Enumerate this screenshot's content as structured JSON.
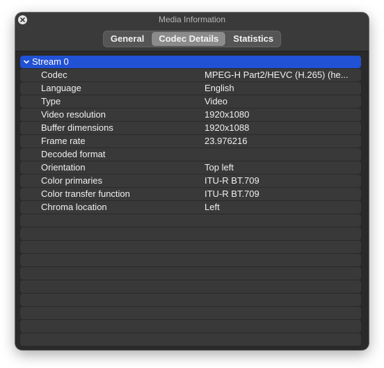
{
  "window": {
    "title": "Media Information",
    "close_icon": "close-icon"
  },
  "tabs": [
    {
      "label": "General",
      "active": false
    },
    {
      "label": "Codec Details",
      "active": true
    },
    {
      "label": "Statistics",
      "active": false
    }
  ],
  "stream": {
    "label": "Stream 0",
    "expanded": true
  },
  "properties": [
    {
      "key": "Codec",
      "value": "MPEG-H Part2/HEVC (H.265) (he..."
    },
    {
      "key": "Language",
      "value": "English"
    },
    {
      "key": "Type",
      "value": "Video"
    },
    {
      "key": "Video resolution",
      "value": "1920x1080"
    },
    {
      "key": "Buffer dimensions",
      "value": "1920x1088"
    },
    {
      "key": "Frame rate",
      "value": "23.976216"
    },
    {
      "key": "Decoded format",
      "value": ""
    },
    {
      "key": "Orientation",
      "value": "Top left"
    },
    {
      "key": "Color primaries",
      "value": "ITU-R BT.709"
    },
    {
      "key": "Color transfer function",
      "value": "ITU-R BT.709"
    },
    {
      "key": "Chroma location",
      "value": "Left"
    }
  ],
  "colors": {
    "window_bg": "#2a2a2a",
    "row_bg": "#393939",
    "selection": "#2151d4",
    "active_tab": "#8b8b8b"
  }
}
